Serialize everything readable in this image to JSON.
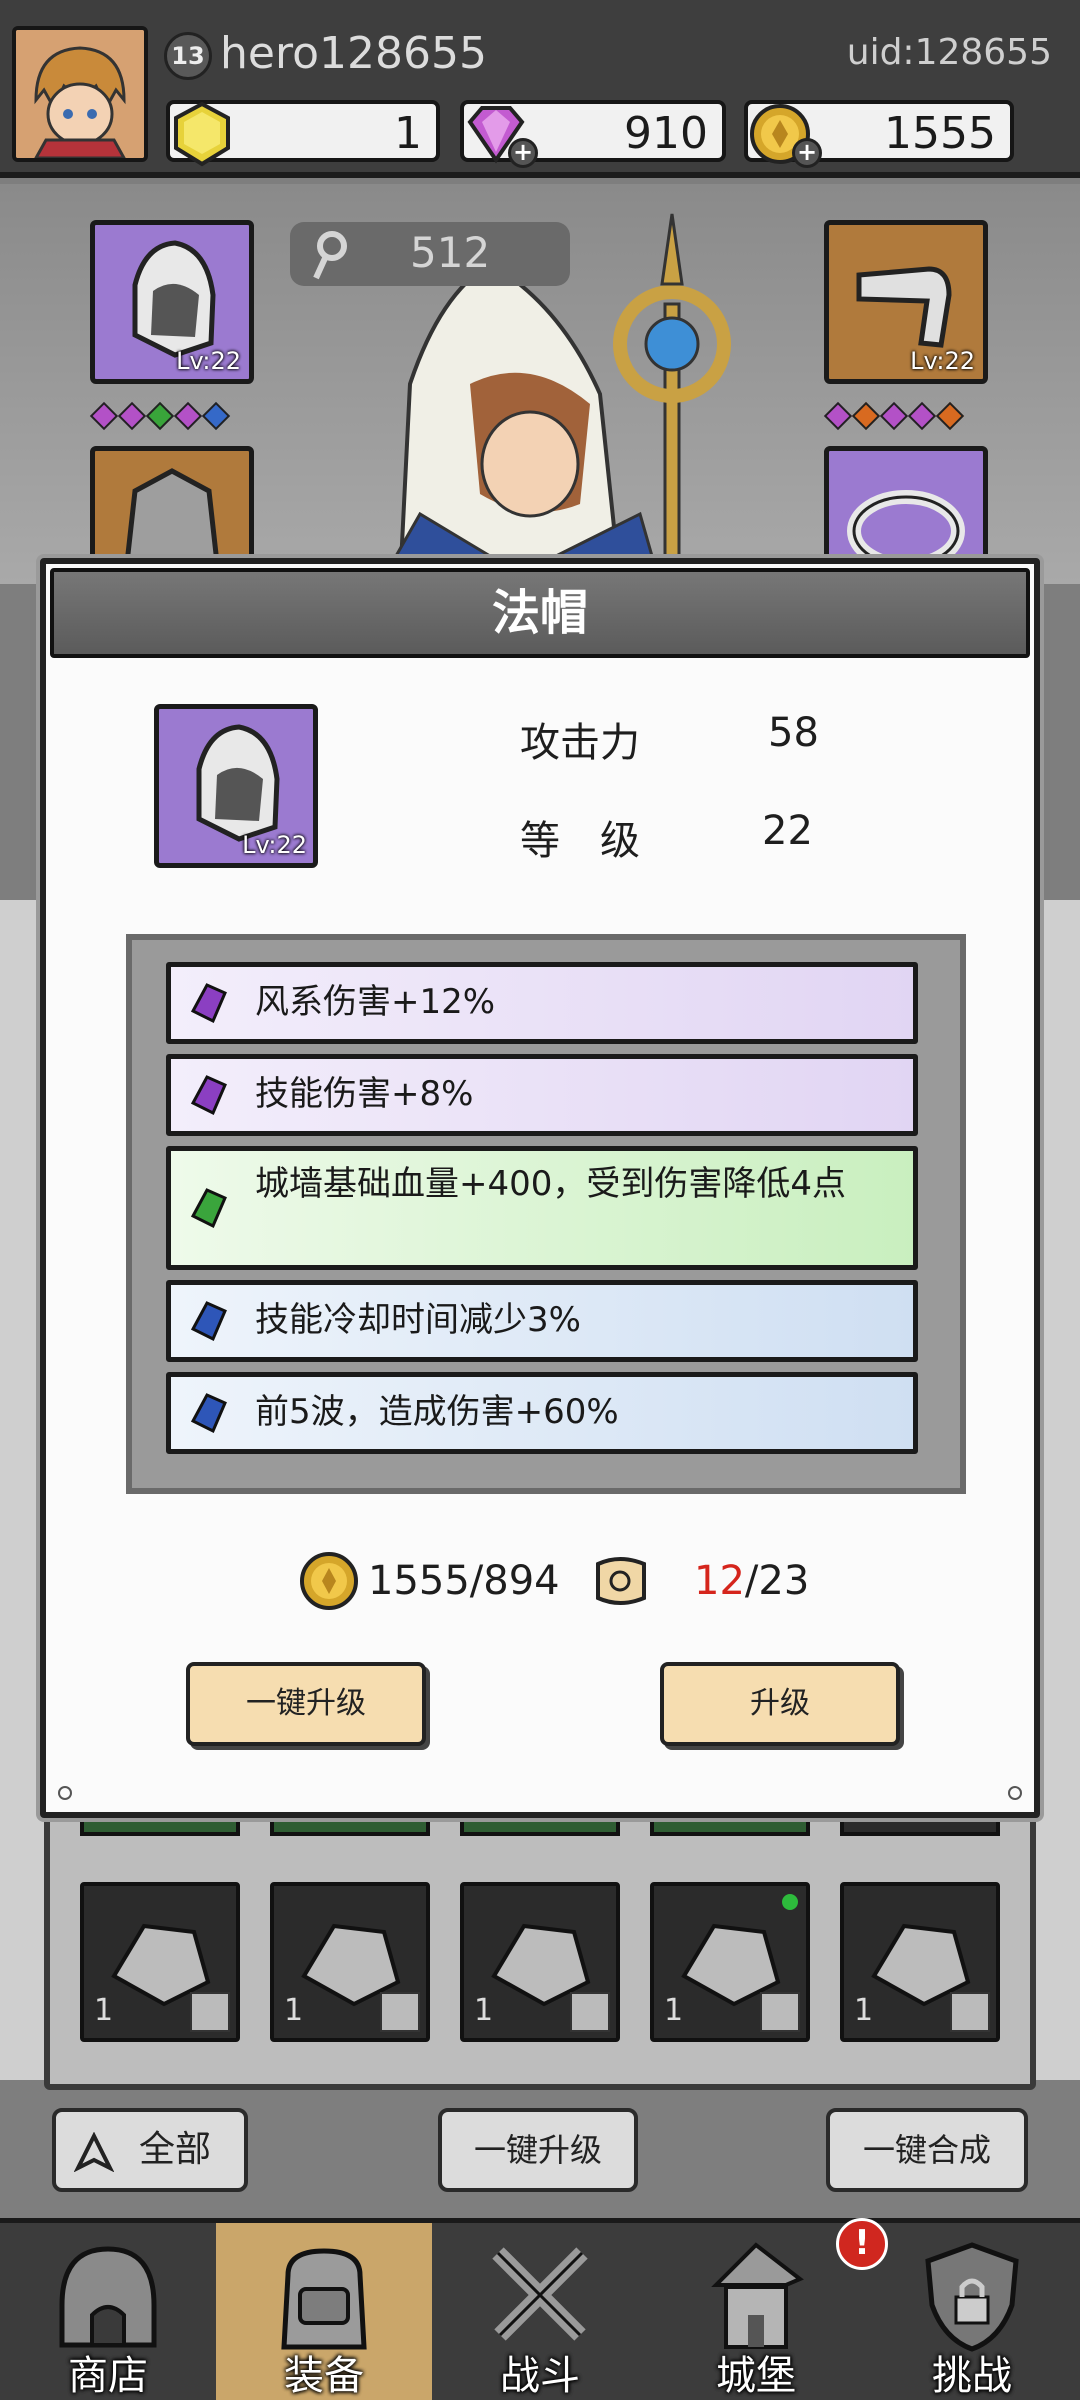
{
  "player": {
    "level": "13",
    "name": "hero128655",
    "uid": "uid:128655"
  },
  "resources": {
    "gold_gem": "1",
    "diamond": "910",
    "coin": "1555"
  },
  "hero": {
    "power": "512",
    "left_top_slot_level": "Lv:22",
    "right_top_slot_level": "Lv:22"
  },
  "modal": {
    "title": "法帽",
    "item_level_badge": "Lv:22",
    "stats": [
      {
        "label": "攻击力",
        "value": "58"
      },
      {
        "label": "等　级",
        "value": "22"
      }
    ],
    "affixes": [
      {
        "text": "风系伤害+12%",
        "tier": "purple"
      },
      {
        "text": "技能伤害+8%",
        "tier": "purple"
      },
      {
        "text": "城墙基础血量+400，受到伤害降低4点",
        "tier": "green"
      },
      {
        "text": "技能冷却时间减少3%",
        "tier": "blue"
      },
      {
        "text": "前5波，造成伤害+60%",
        "tier": "blue"
      }
    ],
    "cost_coin": "1555/894",
    "cost_scroll_have": "12",
    "cost_scroll_need": "/23",
    "btn_upgrade_all": "一键升级",
    "btn_upgrade": "升级"
  },
  "grid": {
    "item_counts": [
      "1",
      "1",
      "1",
      "1",
      "1"
    ]
  },
  "bottom_buttons": {
    "filter": "全部",
    "upgrade_all": "一键升级",
    "merge_all": "一键合成"
  },
  "nav": {
    "items": [
      "商店",
      "装备",
      "战斗",
      "城堡",
      "挑战"
    ],
    "alert": "!"
  },
  "colors": {
    "purple_slot": "#9b7ad0",
    "orange_slot": "#b07a3c",
    "button_bg": "#f6ddb0",
    "alert": "#d0271f"
  }
}
